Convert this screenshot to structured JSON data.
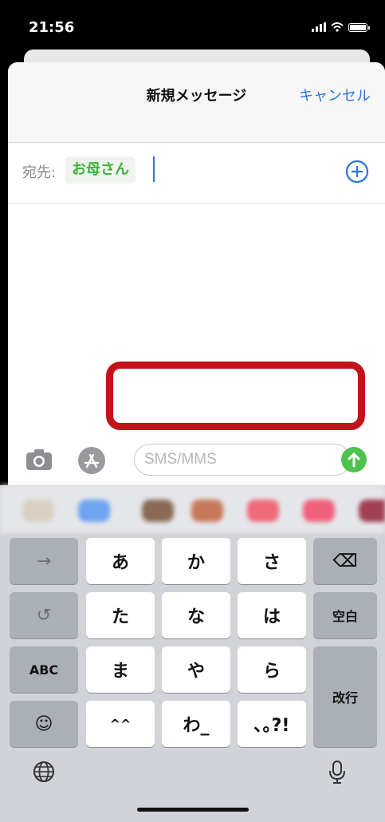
{
  "status_bar": {
    "time": "21:56"
  },
  "header": {
    "title": "新規メッセージ",
    "cancel_label": "キャンセル"
  },
  "to_field": {
    "label": "宛先:",
    "recipient": "お母さん"
  },
  "message": {
    "placeholder": "SMS/MMS",
    "value": ""
  },
  "keyboard": {
    "row1": [
      "→",
      "あ",
      "か",
      "さ",
      "⌫"
    ],
    "row2": [
      "↺",
      "た",
      "な",
      "は",
      "空白"
    ],
    "row3": [
      "ABC",
      "ま",
      "や",
      "ら",
      "改行"
    ],
    "row4": [
      "☺",
      "^^",
      "わ_",
      "､｡?!"
    ]
  },
  "colors": {
    "accent": "#2a74d8",
    "recipient": "#3fb33f",
    "highlight": "#c4121b",
    "send": "#4ec24e"
  }
}
